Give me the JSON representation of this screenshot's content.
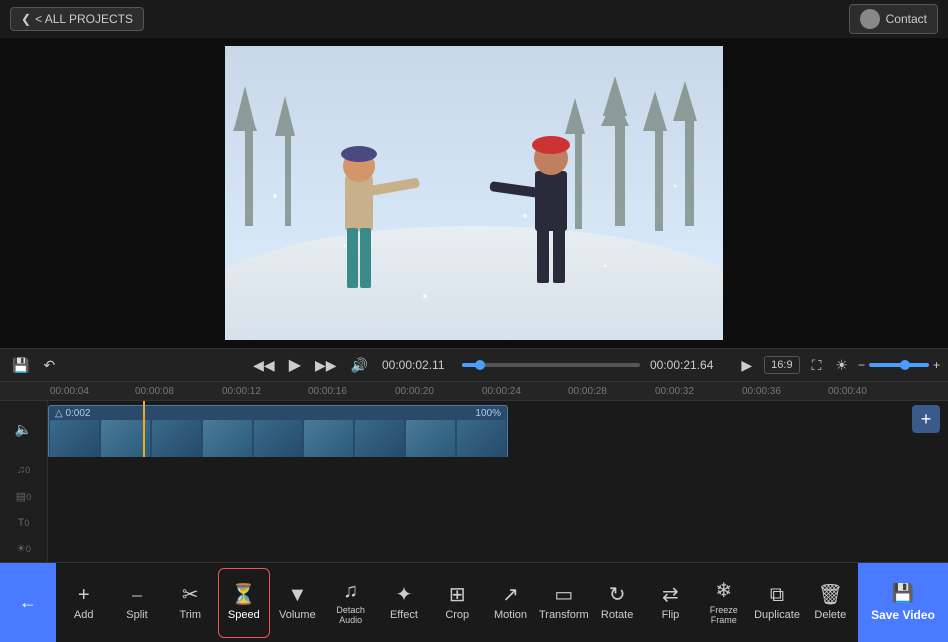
{
  "topBar": {
    "backButton": "< ALL PROJECTS",
    "contactButton": "Contact"
  },
  "transport": {
    "currentTime": "00:00:02.11",
    "totalTime": "00:00:21.64",
    "aspectRatio": "16:9",
    "progressPercent": 10
  },
  "timeline": {
    "rulers": [
      "00:00:04",
      "00:00:08",
      "00:00:12",
      "00:00:16",
      "00:00:20",
      "00:00:24",
      "00:00:28",
      "00:00:32",
      "00:00:36",
      "00:00:40"
    ],
    "clip": {
      "label": "0:002",
      "duration": "100%"
    },
    "tracks": [
      {
        "icon": "♪",
        "count": "0"
      },
      {
        "icon": "◫",
        "count": "0"
      },
      {
        "icon": "T",
        "count": "0"
      },
      {
        "icon": "🖼",
        "count": "0"
      }
    ]
  },
  "toolbar": {
    "tools": [
      {
        "id": "add",
        "label": "Add",
        "icon": "+"
      },
      {
        "id": "split",
        "label": "Split",
        "icon": "⫸"
      },
      {
        "id": "trim",
        "label": "Trim",
        "icon": "✂"
      },
      {
        "id": "speed",
        "label": "Speed",
        "icon": "⏱",
        "active": true
      },
      {
        "id": "volume",
        "label": "Volume",
        "icon": "◁"
      },
      {
        "id": "detach-audio",
        "label": "Detach Audio",
        "icon": "♪"
      },
      {
        "id": "effect",
        "label": "Effect",
        "icon": "✦"
      },
      {
        "id": "crop",
        "label": "Crop",
        "icon": "⊡"
      },
      {
        "id": "motion",
        "label": "Motion",
        "icon": "⤢"
      },
      {
        "id": "transform",
        "label": "Transform",
        "icon": "▭"
      },
      {
        "id": "rotate",
        "label": "Rotate",
        "icon": "↻"
      },
      {
        "id": "flip",
        "label": "Flip",
        "icon": "⇌"
      },
      {
        "id": "freeze-frame",
        "label": "Freeze Frame",
        "icon": "❄"
      },
      {
        "id": "duplicate",
        "label": "Duplicate",
        "icon": "⧉"
      },
      {
        "id": "delete",
        "label": "Delete",
        "icon": "🗑"
      }
    ],
    "backIcon": "←",
    "saveLabel": "Save Video"
  }
}
